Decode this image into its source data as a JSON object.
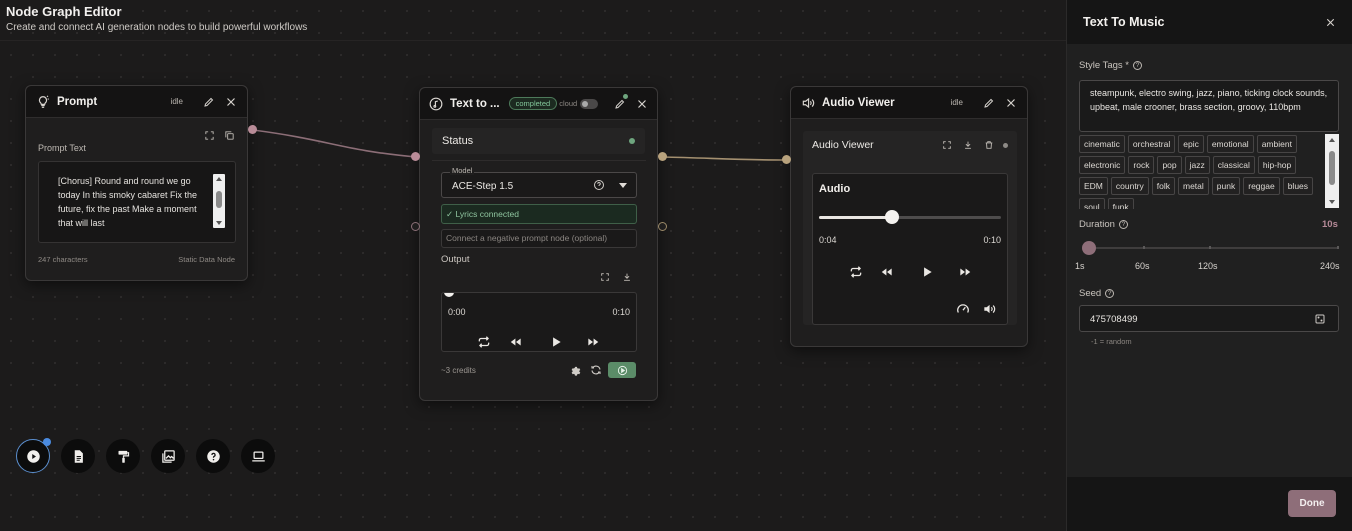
{
  "header": {
    "title": "Node Graph Editor",
    "subtitle": "Create and connect AI generation nodes to build powerful workflows"
  },
  "prompt_node": {
    "title": "Prompt",
    "status": "idle",
    "field_label": "Prompt Text",
    "text": "[Chorus] Round and round we go today In this smoky cabaret Fix the future, fix the past Make a moment that will last",
    "char_count": "247 characters",
    "node_type": "Static Data Node"
  },
  "ttm_node": {
    "title": "Text to ...",
    "status_badge": "completed",
    "cloud_label": "cloud",
    "status_label": "Status",
    "model_label": "Model",
    "model_value": "ACE-Step 1.5",
    "lyrics_status": "✓ Lyrics connected",
    "negative_placeholder": "Connect a negative prompt node (optional)",
    "output_label": "Output",
    "time_current": "0:00",
    "time_total": "0:10",
    "credits": "~3 credits"
  },
  "audio_node": {
    "title": "Audio Viewer",
    "status": "idle",
    "section_title": "Audio Viewer",
    "player_title": "Audio",
    "time_current": "0:04",
    "time_total": "0:10",
    "progress": 0.4
  },
  "panel": {
    "title": "Text To Music",
    "style_label": "Style Tags *",
    "style_value": "steampunk, electro swing, jazz, piano, ticking clock sounds, upbeat, male crooner, brass section, groovy, 110bpm",
    "tags": [
      "cinematic",
      "orchestral",
      "epic",
      "emotional",
      "ambient",
      "electronic",
      "rock",
      "pop",
      "jazz",
      "classical",
      "hip-hop",
      "EDM",
      "country",
      "folk",
      "metal",
      "punk",
      "reggae",
      "blues",
      "soul",
      "funk"
    ],
    "duration_label": "Duration",
    "duration_value": "10s",
    "duration_ticks": [
      "1s",
      "60s",
      "120s",
      "240s"
    ],
    "seed_label": "Seed",
    "seed_value": "475708499",
    "seed_hint": "-1 = random",
    "done_label": "Done"
  },
  "colors": {
    "accent": "#8e6e79",
    "success": "#6ea57e",
    "port_pink": "#b98c98",
    "port_tan": "#b8a27d",
    "toolbar_active": "#4a8be0"
  }
}
